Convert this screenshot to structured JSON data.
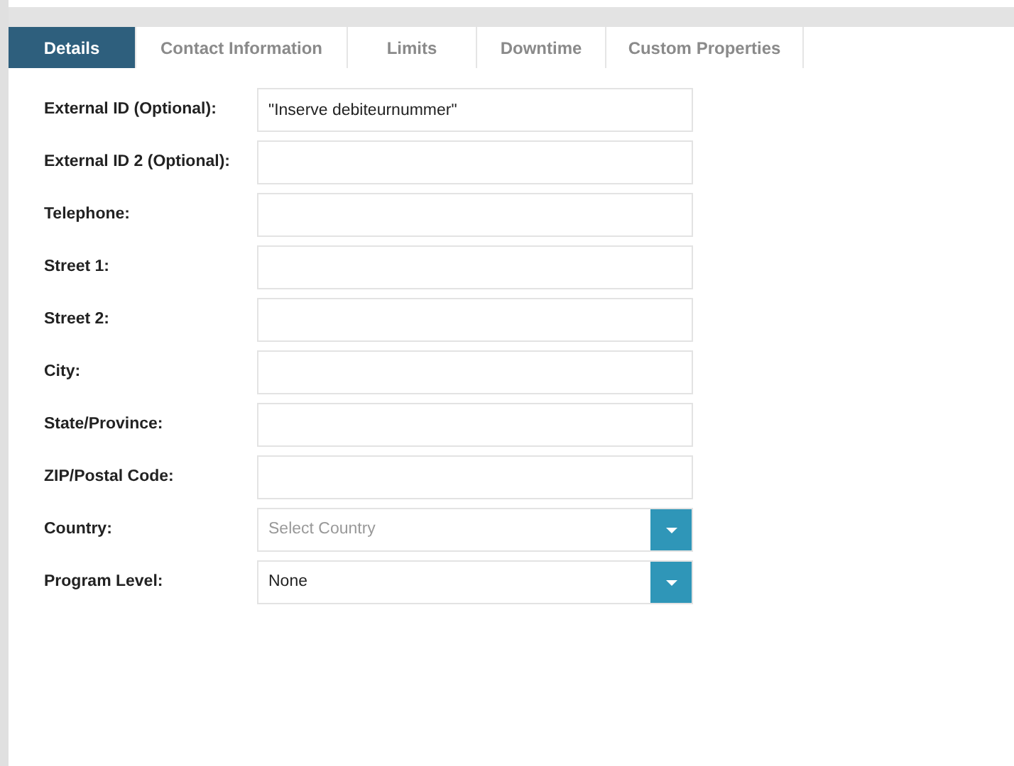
{
  "tabs": [
    {
      "label": "Details",
      "selected": true
    },
    {
      "label": "Contact Information",
      "selected": false
    },
    {
      "label": "Limits",
      "selected": false
    },
    {
      "label": "Downtime",
      "selected": false
    },
    {
      "label": "Custom Properties",
      "selected": false
    }
  ],
  "fields": [
    {
      "kind": "text",
      "label": "External ID (Optional):",
      "value": "\"Inserve debiteurnummer\""
    },
    {
      "kind": "text",
      "label": "External ID 2 (Optional):"
    },
    {
      "kind": "text",
      "label": "Telephone:"
    },
    {
      "kind": "text",
      "label": "Street 1:"
    },
    {
      "kind": "text",
      "label": "Street 2:"
    },
    {
      "kind": "text",
      "label": "City:"
    },
    {
      "kind": "text",
      "label": "State/Province:"
    },
    {
      "kind": "text",
      "label": "ZIP/Postal Code:"
    },
    {
      "kind": "select",
      "label": "Country:",
      "placeholder": "Select Country"
    },
    {
      "kind": "select",
      "label": "Program Level:",
      "value": "None"
    }
  ]
}
